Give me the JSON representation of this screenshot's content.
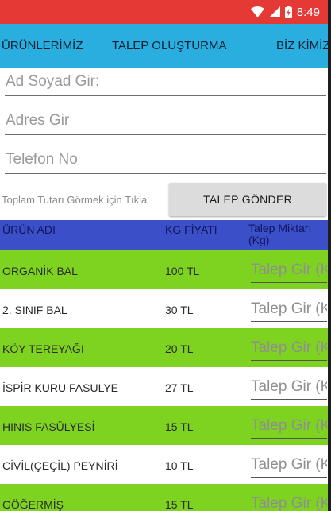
{
  "status_bar": {
    "time": "8:49",
    "colors": {
      "background": "#e53935"
    },
    "icons": [
      "wifi-icon",
      "signal-icon",
      "battery-icon"
    ]
  },
  "tabs": [
    {
      "label": "ÜRÜNLERİMİZ"
    },
    {
      "label": "TALEP OLUŞTURMA"
    },
    {
      "label": "BİZ KİMİZ"
    }
  ],
  "form": {
    "name_placeholder": "Ad Soyad Gir:",
    "address_placeholder": "Adres Gir",
    "phone_placeholder": "Telefon No",
    "total_hint": "Toplam Tutarı Görmek için Tıkla",
    "submit_label": "TALEP GÖNDER"
  },
  "table": {
    "headers": {
      "product": "ÜRÜN ADI",
      "price": "KG FİYATI",
      "quantity": "Talep Miktarı (Kg)"
    },
    "colors": {
      "header": "#3a4fc8",
      "alt_row": "#7ed321"
    },
    "rows": [
      {
        "name": "ORGANİK BAL",
        "price": "100 TL",
        "qty_placeholder": "Talep Gir (Kg)"
      },
      {
        "name": "2. SINIF BAL",
        "price": "30 TL",
        "qty_placeholder": "Talep Gir (Kg)"
      },
      {
        "name": "KÖY TEREYAĞI",
        "price": "20 TL",
        "qty_placeholder": "Talep Gir (Kg)"
      },
      {
        "name": "İSPİR KURU FASULYE",
        "price": "27 TL",
        "qty_placeholder": "Talep Gir (Kg)"
      },
      {
        "name": "HINIS FASÜLYESİ",
        "price": "15 TL",
        "qty_placeholder": "Talep Gir (Kg)"
      },
      {
        "name": "CİVİL(ÇEÇİL) PEYNİRİ",
        "price": "10 TL",
        "qty_placeholder": "Talep Gir (Kg)"
      },
      {
        "name": "GÖĞERMİŞ",
        "price": "15 TL",
        "qty_placeholder": "Talep Gir (Kg)"
      }
    ]
  }
}
